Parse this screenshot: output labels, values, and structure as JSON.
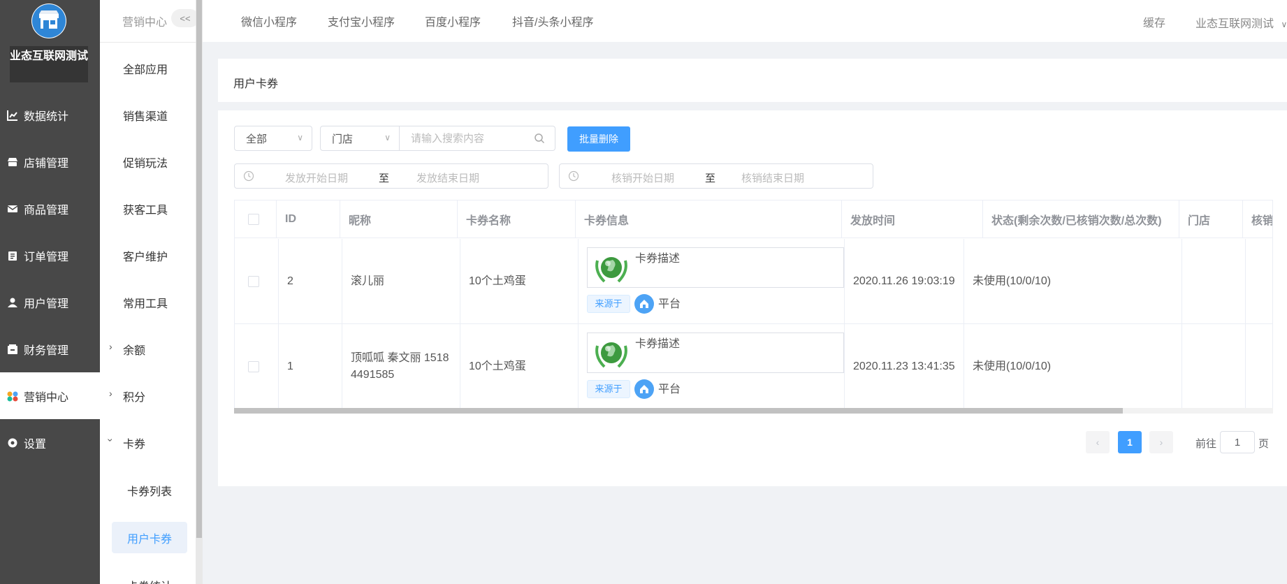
{
  "sidebar": {
    "shop_name": "业态互联网测试",
    "items": [
      {
        "label": "数据统计",
        "icon": "chart-line-icon"
      },
      {
        "label": "店铺管理",
        "icon": "store-icon"
      },
      {
        "label": "商品管理",
        "icon": "mail-icon"
      },
      {
        "label": "订单管理",
        "icon": "clipboard-icon"
      },
      {
        "label": "用户管理",
        "icon": "user-icon"
      },
      {
        "label": "财务管理",
        "icon": "wallet-icon"
      },
      {
        "label": "营销中心",
        "icon": "marketing-icon",
        "active": true
      },
      {
        "label": "设置",
        "icon": "settings-icon"
      }
    ]
  },
  "submenu": {
    "header": "营销中心",
    "collapse_label": "<<",
    "items": [
      "全部应用",
      "销售渠道",
      "促销玩法",
      "获客工具",
      "客户维护",
      "常用工具"
    ],
    "groups": [
      {
        "label": "余额",
        "expanded": false
      },
      {
        "label": "积分",
        "expanded": false
      },
      {
        "label": "卡券",
        "expanded": true
      }
    ],
    "coupon_children": [
      "卡券列表",
      "用户卡券",
      "卡券统计"
    ],
    "active_child": "用户卡券"
  },
  "topbar": {
    "tabs": [
      "微信小程序",
      "支付宝小程序",
      "百度小程序",
      "抖音/头条小程序"
    ],
    "cache_label": "缓存",
    "user_name": "业态互联网测试"
  },
  "page_title": "用户卡券",
  "filters": {
    "type_select": "全部",
    "store_select": "门店",
    "search_placeholder": "请输入搜索内容",
    "batch_delete_label": "批量删除",
    "issue_range": {
      "start_placeholder": "发放开始日期",
      "separator": "至",
      "end_placeholder": "发放结束日期"
    },
    "verify_range": {
      "start_placeholder": "核销开始日期",
      "separator": "至",
      "end_placeholder": "核销结束日期"
    }
  },
  "table": {
    "columns": [
      "ID",
      "昵称",
      "卡券名称",
      "卡券信息",
      "发放时间",
      "状态(剩余次数/已核销次数/总次数)",
      "门店",
      "核销"
    ],
    "rows": [
      {
        "id": "2",
        "nickname": "滚儿丽",
        "coupon_name": "10个土鸡蛋",
        "coupon_desc": "卡券描述",
        "source_tag": "来源于",
        "platform": "平台",
        "issue_time": "2020.11.26 19:03:19",
        "status": "未使用(10/0/10)"
      },
      {
        "id": "1",
        "nickname": "顶呱呱 秦文丽 15184491585",
        "coupon_name": "10个土鸡蛋",
        "coupon_desc": "卡券描述",
        "source_tag": "来源于",
        "platform": "平台",
        "issue_time": "2020.11.23 13:41:35",
        "status": "未使用(10/0/10)"
      }
    ]
  },
  "pagination": {
    "prev": "‹",
    "current": "1",
    "next": "›",
    "goto_label": "前往",
    "goto_value": "1",
    "page_suffix": "页"
  },
  "colors": {
    "primary": "#409eff",
    "sidebar_bg": "#484848"
  }
}
